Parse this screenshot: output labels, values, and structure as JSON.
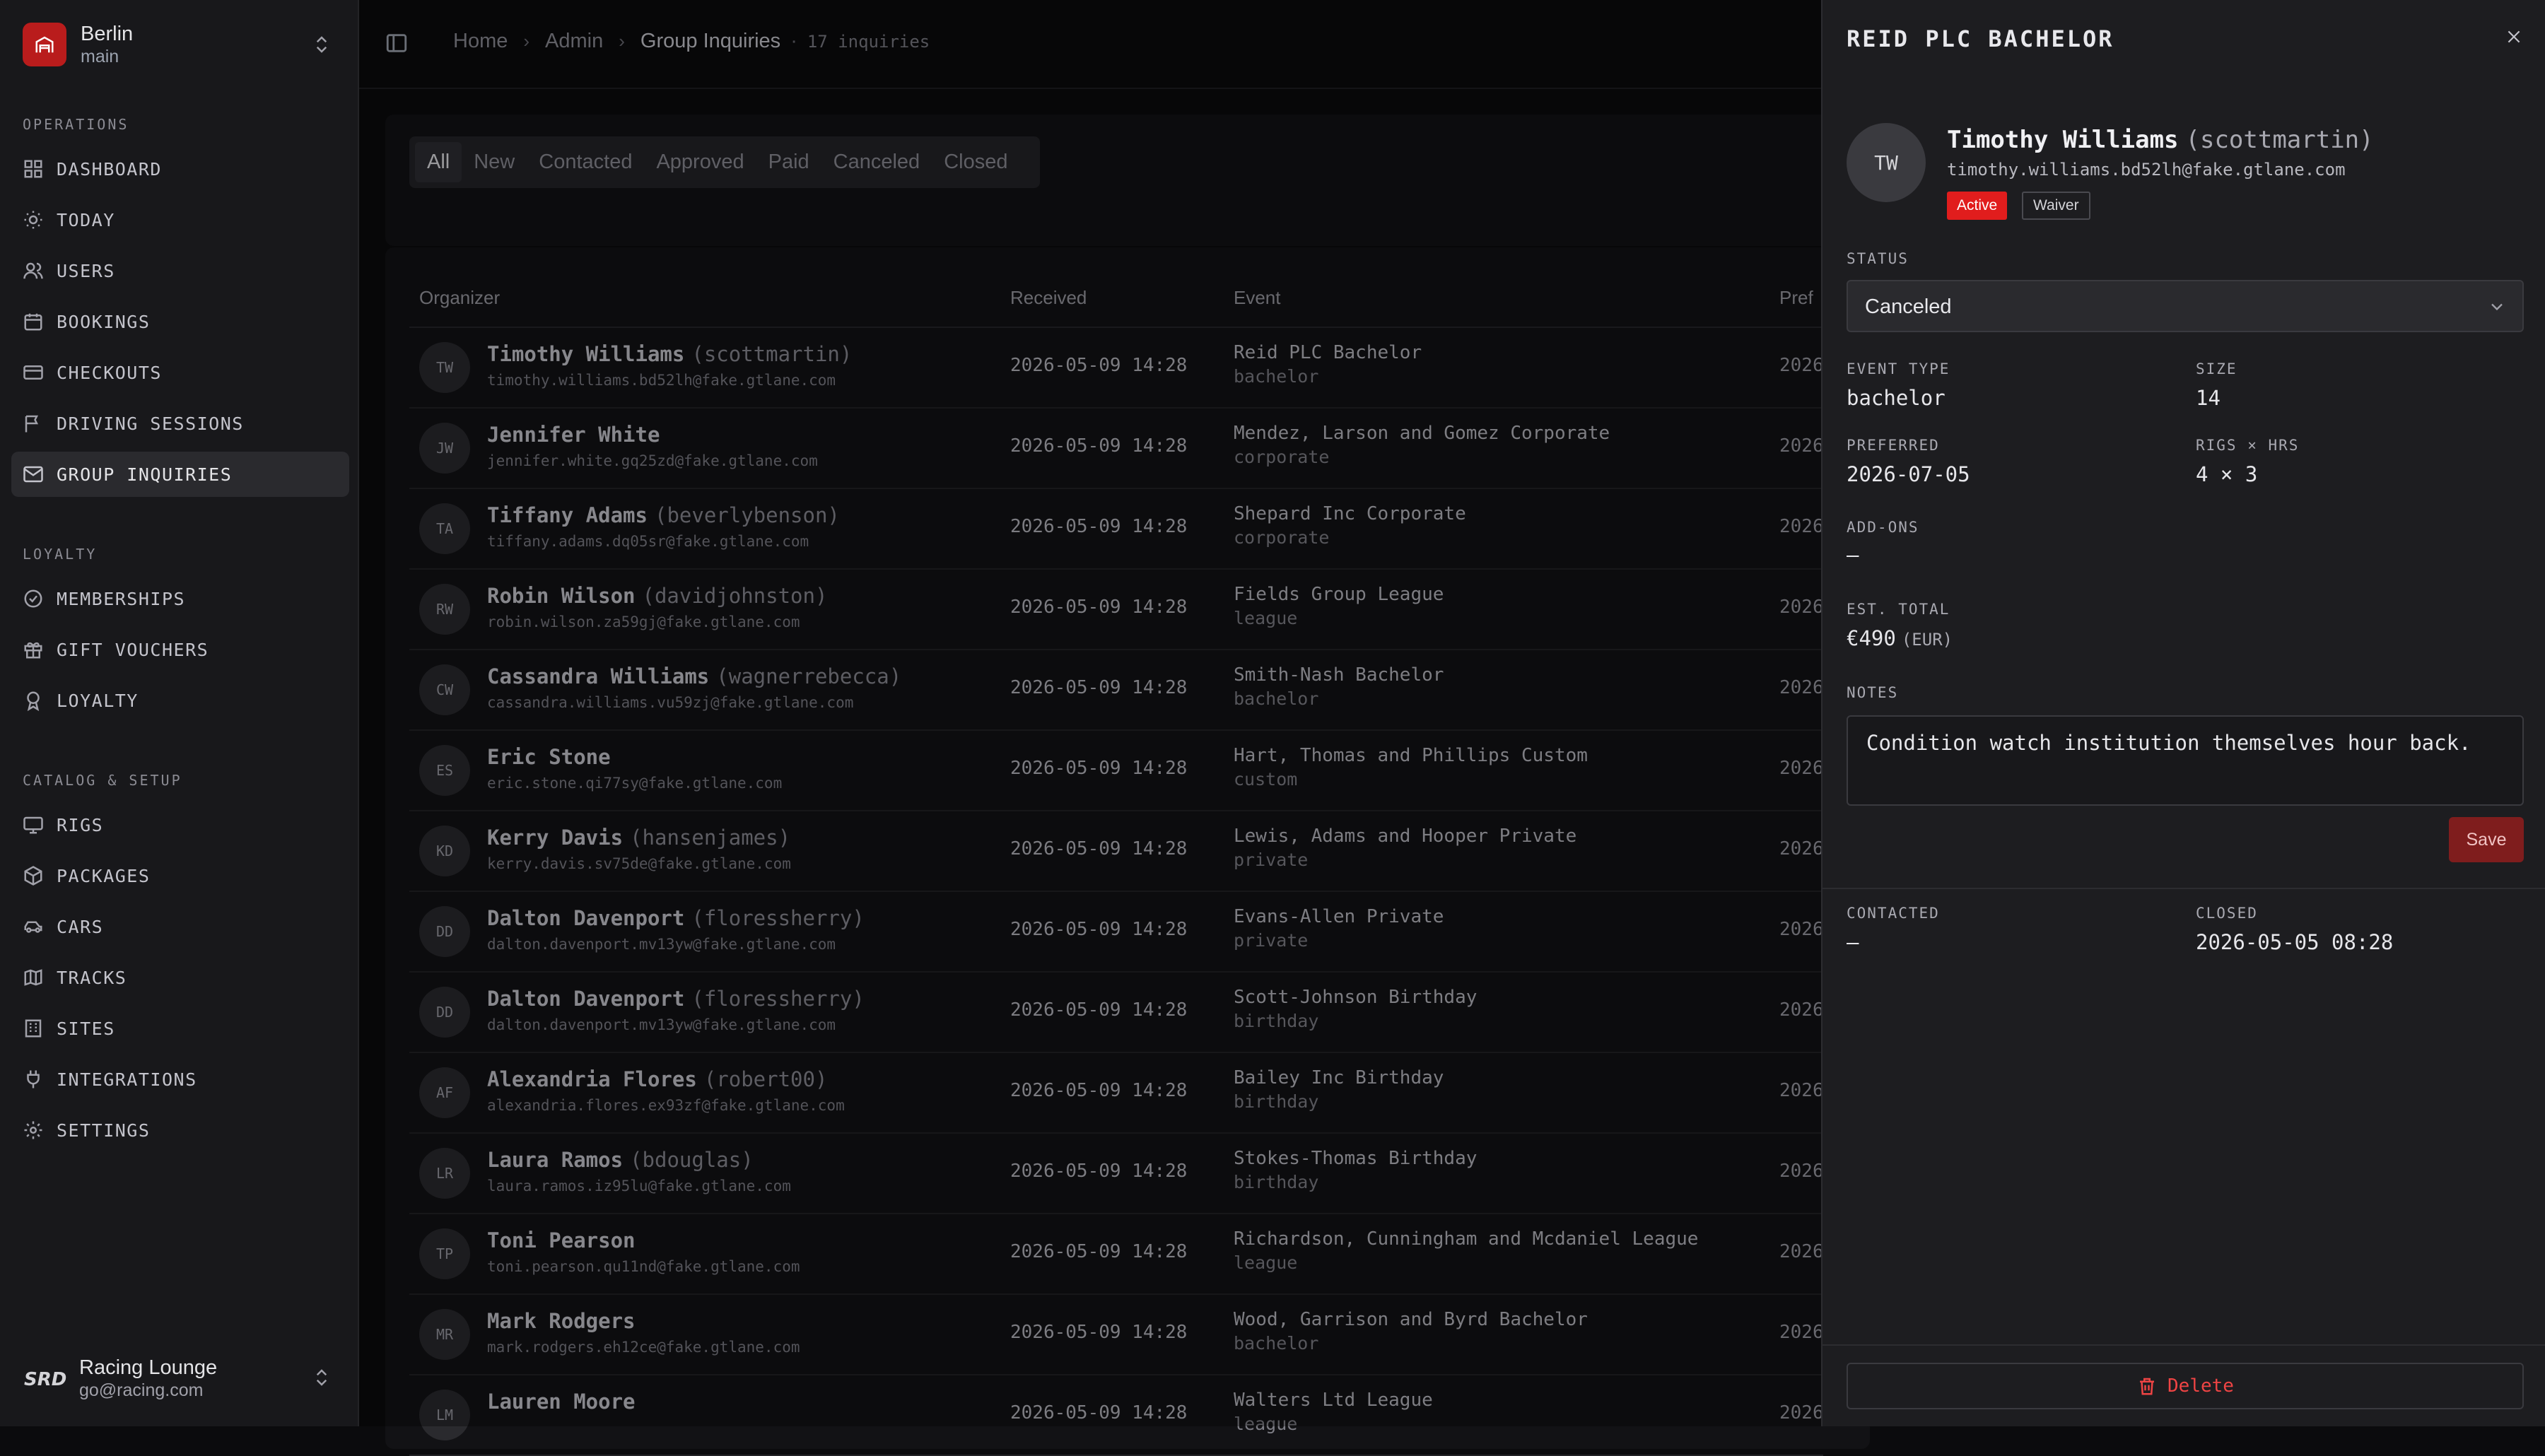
{
  "workspace": {
    "name": "Berlin",
    "branch": "main"
  },
  "nav": {
    "operations_label": "OPERATIONS",
    "loyalty_label": "LOYALTY",
    "catalog_label": "CATALOG & SETUP",
    "items": [
      {
        "label": "DASHBOARD",
        "icon": "grid-icon"
      },
      {
        "label": "TODAY",
        "icon": "sun-icon"
      },
      {
        "label": "USERS",
        "icon": "users-icon"
      },
      {
        "label": "BOOKINGS",
        "icon": "calendar-icon"
      },
      {
        "label": "CHECKOUTS",
        "icon": "credit-card-icon"
      },
      {
        "label": "DRIVING SESSIONS",
        "icon": "flag-icon"
      },
      {
        "label": "GROUP INQUIRIES",
        "icon": "mail-icon"
      },
      {
        "label": "MEMBERSHIPS",
        "icon": "check-circle-icon"
      },
      {
        "label": "GIFT VOUCHERS",
        "icon": "gift-icon"
      },
      {
        "label": "LOYALTY",
        "icon": "award-icon"
      },
      {
        "label": "RIGS",
        "icon": "monitor-icon"
      },
      {
        "label": "PACKAGES",
        "icon": "package-icon"
      },
      {
        "label": "CARS",
        "icon": "car-icon"
      },
      {
        "label": "TRACKS",
        "icon": "map-icon"
      },
      {
        "label": "SITES",
        "icon": "building-icon"
      },
      {
        "label": "INTEGRATIONS",
        "icon": "plug-icon"
      },
      {
        "label": "SETTINGS",
        "icon": "gear-icon"
      }
    ]
  },
  "account": {
    "name": "Racing Lounge",
    "email": "go@racing.com",
    "logo_text": "SRD"
  },
  "breadcrumb": {
    "home": "Home",
    "admin": "Admin",
    "current": "Group Inquiries",
    "count": "17 inquiries"
  },
  "filters": [
    "All",
    "New",
    "Contacted",
    "Approved",
    "Paid",
    "Canceled",
    "Closed"
  ],
  "table": {
    "headers": {
      "organizer": "Organizer",
      "received": "Received",
      "event": "Event",
      "preferred": "Pref"
    },
    "rows": [
      {
        "initials": "TW",
        "name": "Timothy Williams",
        "user": "(scottmartin)",
        "email": "timothy.williams.bd52lh@fake.gtlane.com",
        "received": "2026-05-09 14:28",
        "event": "Reid PLC Bachelor",
        "type": "bachelor",
        "pref": "2026"
      },
      {
        "initials": "JW",
        "name": "Jennifer White",
        "user": "",
        "email": "jennifer.white.gq25zd@fake.gtlane.com",
        "received": "2026-05-09 14:28",
        "event": "Mendez, Larson and Gomez Corporate",
        "type": "corporate",
        "pref": "2026"
      },
      {
        "initials": "TA",
        "name": "Tiffany Adams",
        "user": "(beverlybenson)",
        "email": "tiffany.adams.dq05sr@fake.gtlane.com",
        "received": "2026-05-09 14:28",
        "event": "Shepard Inc Corporate",
        "type": "corporate",
        "pref": "2026"
      },
      {
        "initials": "RW",
        "name": "Robin Wilson",
        "user": "(davidjohnston)",
        "email": "robin.wilson.za59gj@fake.gtlane.com",
        "received": "2026-05-09 14:28",
        "event": "Fields Group League",
        "type": "league",
        "pref": "2026"
      },
      {
        "initials": "CW",
        "name": "Cassandra Williams",
        "user": "(wagnerrebecca)",
        "email": "cassandra.williams.vu59zj@fake.gtlane.com",
        "received": "2026-05-09 14:28",
        "event": "Smith-Nash Bachelor",
        "type": "bachelor",
        "pref": "2026"
      },
      {
        "initials": "ES",
        "name": "Eric Stone",
        "user": "",
        "email": "eric.stone.qi77sy@fake.gtlane.com",
        "received": "2026-05-09 14:28",
        "event": "Hart, Thomas and Phillips Custom",
        "type": "custom",
        "pref": "2026"
      },
      {
        "initials": "KD",
        "name": "Kerry Davis",
        "user": "(hansenjames)",
        "email": "kerry.davis.sv75de@fake.gtlane.com",
        "received": "2026-05-09 14:28",
        "event": "Lewis, Adams and Hooper Private",
        "type": "private",
        "pref": "2026"
      },
      {
        "initials": "DD",
        "name": "Dalton Davenport",
        "user": "(floressherry)",
        "email": "dalton.davenport.mv13yw@fake.gtlane.com",
        "received": "2026-05-09 14:28",
        "event": "Evans-Allen Private",
        "type": "private",
        "pref": "2026"
      },
      {
        "initials": "DD",
        "name": "Dalton Davenport",
        "user": "(floressherry)",
        "email": "dalton.davenport.mv13yw@fake.gtlane.com",
        "received": "2026-05-09 14:28",
        "event": "Scott-Johnson Birthday",
        "type": "birthday",
        "pref": "2026"
      },
      {
        "initials": "AF",
        "name": "Alexandria Flores",
        "user": "(robert00)",
        "email": "alexandria.flores.ex93zf@fake.gtlane.com",
        "received": "2026-05-09 14:28",
        "event": "Bailey Inc Birthday",
        "type": "birthday",
        "pref": "2026"
      },
      {
        "initials": "LR",
        "name": "Laura Ramos",
        "user": "(bdouglas)",
        "email": "laura.ramos.iz95lu@fake.gtlane.com",
        "received": "2026-05-09 14:28",
        "event": "Stokes-Thomas Birthday",
        "type": "birthday",
        "pref": "2026"
      },
      {
        "initials": "TP",
        "name": "Toni Pearson",
        "user": "",
        "email": "toni.pearson.qu11nd@fake.gtlane.com",
        "received": "2026-05-09 14:28",
        "event": "Richardson, Cunningham and Mcdaniel League",
        "type": "league",
        "pref": "2026"
      },
      {
        "initials": "MR",
        "name": "Mark Rodgers",
        "user": "",
        "email": "mark.rodgers.eh12ce@fake.gtlane.com",
        "received": "2026-05-09 14:28",
        "event": "Wood, Garrison and Byrd Bachelor",
        "type": "bachelor",
        "pref": "2026"
      },
      {
        "initials": "LM",
        "name": "Lauren Moore",
        "user": "",
        "email": "",
        "received": "2026-05-09 14:28",
        "event": "Walters Ltd League",
        "type": "league",
        "pref": "2026"
      }
    ]
  },
  "drawer": {
    "title": "REID PLC BACHELOR",
    "initials": "TW",
    "name": "Timothy Williams",
    "user": "(scottmartin)",
    "email": "timothy.williams.bd52lh@fake.gtlane.com",
    "badge_active": "Active",
    "badge_waiver": "Waiver",
    "status_label": "STATUS",
    "status_value": "Canceled",
    "event_type_label": "EVENT TYPE",
    "event_type": "bachelor",
    "size_label": "SIZE",
    "size": "14",
    "preferred_label": "PREFERRED",
    "preferred": "2026-07-05",
    "rigs_label": "RIGS × HRS",
    "rigs": "4 × 3",
    "addons_label": "ADD-ONS",
    "addons": "—",
    "total_label": "EST. TOTAL",
    "total": "€490",
    "currency": "(EUR)",
    "notes_label": "NOTES",
    "notes": "Condition watch institution themselves hour back.",
    "save_label": "Save",
    "contacted_label": "CONTACTED",
    "contacted": "—",
    "closed_label": "CLOSED",
    "closed": "2026-05-05 08:28",
    "delete_label": "Delete"
  },
  "colors": {
    "accent": "#e11d1d",
    "save": "#7f1d1d",
    "danger": "#ef4444",
    "background": "#0b0b0d",
    "panel": "#1d1d20"
  }
}
